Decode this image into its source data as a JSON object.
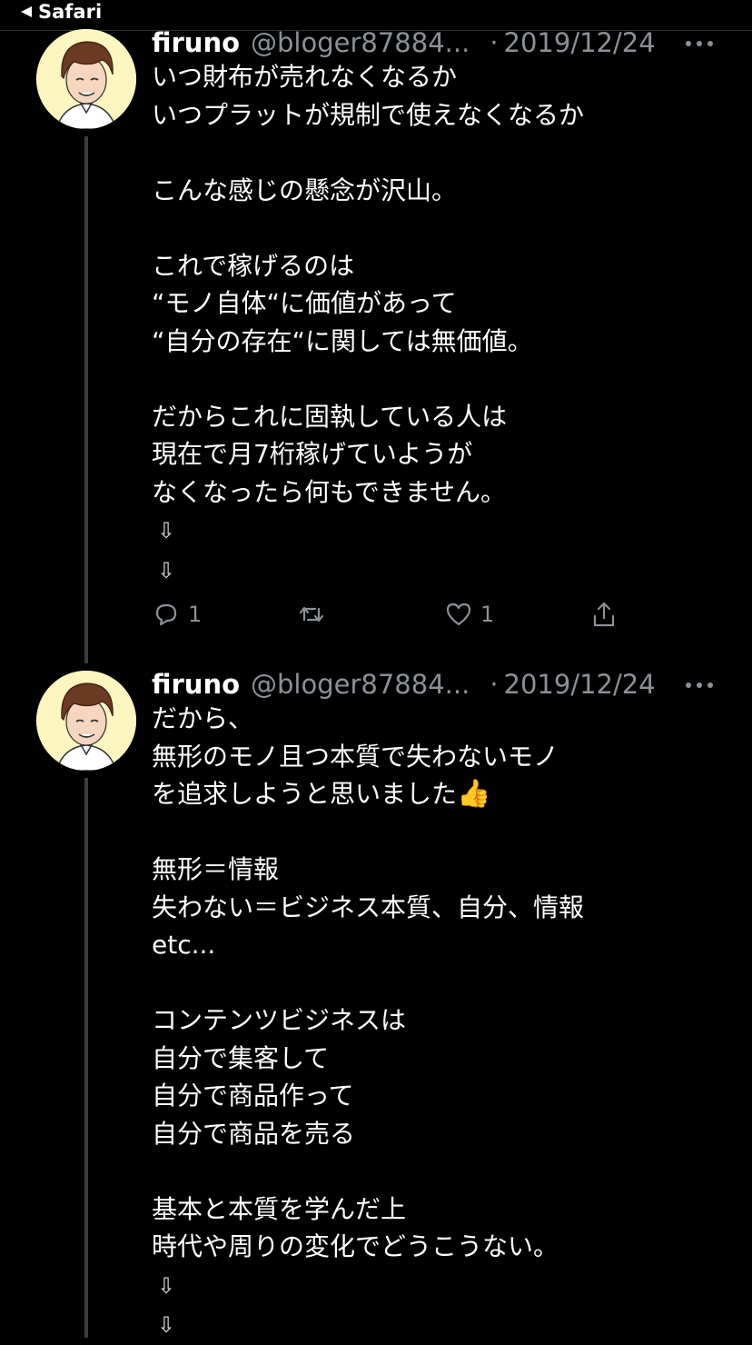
{
  "status_bar": {
    "back_label": "Safari"
  },
  "tweets": [
    {
      "name": "firuno",
      "handle": "@bloger87884...",
      "separator": "·",
      "date": "2019/12/24",
      "text": "いつ財布が売れなくなるか\nいつプラットが規制で使えなくなるか\n\nこんな感じの懸念が沢山。\n\nこれで稼げるのは\n“モノ自体“に価値があって\n“自分の存在“に関しては無価値。\n\nだからこれに固執している人は\n現在で月7桁稼げていようが\nなくなったら何もできません。",
      "arrows": [
        "⇩",
        "⇩"
      ],
      "reply_count": "1",
      "retweet_count": "",
      "like_count": "1"
    },
    {
      "name": "firuno",
      "handle": "@bloger87884...",
      "separator": "·",
      "date": "2019/12/24",
      "text_before_emoji": "だから、\n無形のモノ且つ本質で失わないモノ\nを追求しようと思いました",
      "emoji": "👍",
      "text_after_emoji": "\n\n無形＝情報\n失わない＝ビジネス本質、自分、情報\netc...\n\nコンテンツビジネスは\n自分で集客して\n自分で商品作って\n自分で商品を売る\n\n基本と本質を学んだ上\n時代や周りの変化でどうこうない。",
      "arrows": [
        "⇩",
        "⇩"
      ]
    }
  ],
  "icons": {
    "back": "back-triangle-icon",
    "more": "more-dots-icon",
    "reply": "reply-bubble-icon",
    "retweet": "retweet-icon",
    "like": "heart-icon",
    "share": "share-icon"
  },
  "colors": {
    "background": "#000000",
    "text": "#ffffff",
    "muted": "#8b9197",
    "avatar_bg": "#fdf6c0"
  }
}
